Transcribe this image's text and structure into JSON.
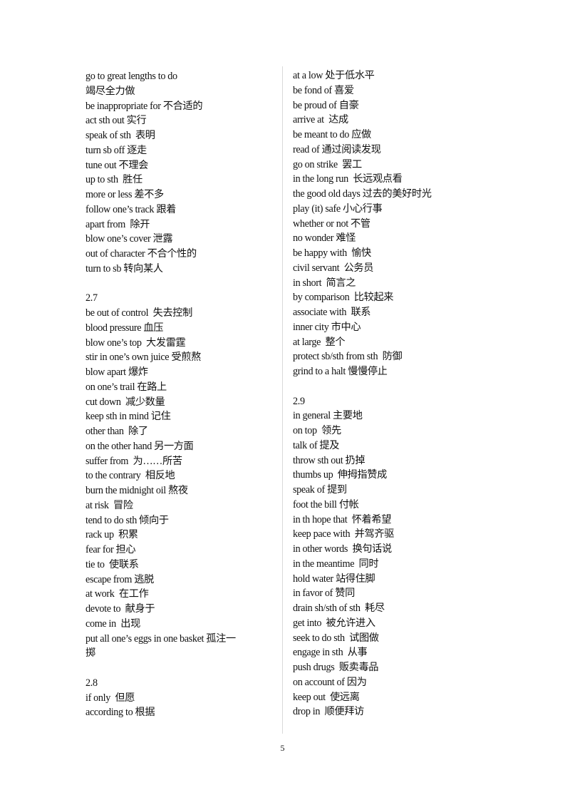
{
  "left_column": [
    {
      "type": "entry",
      "text": "go to great lengths to do"
    },
    {
      "type": "entry",
      "text": "竭尽全力做"
    },
    {
      "type": "entry",
      "text": "be inappropriate for 不合适的"
    },
    {
      "type": "entry",
      "text": "act sth out 实行"
    },
    {
      "type": "entry",
      "text": "speak of sth  表明"
    },
    {
      "type": "entry",
      "text": "turn sb off 逐走"
    },
    {
      "type": "entry",
      "text": "tune out 不理会"
    },
    {
      "type": "entry",
      "text": "up to sth  胜任"
    },
    {
      "type": "entry",
      "text": "more or less 差不多"
    },
    {
      "type": "entry",
      "text": "follow one’s track 跟着"
    },
    {
      "type": "entry",
      "text": "apart from  除开"
    },
    {
      "type": "entry",
      "text": "blow one’s cover 泄露"
    },
    {
      "type": "entry",
      "text": "out of character 不合个性的"
    },
    {
      "type": "entry",
      "text": "turn to sb 转向某人"
    },
    {
      "type": "blank",
      "text": ""
    },
    {
      "type": "heading",
      "text": "2.7"
    },
    {
      "type": "entry",
      "text": "be out of control  失去控制"
    },
    {
      "type": "entry",
      "text": "blood pressure 血压"
    },
    {
      "type": "entry",
      "text": "blow one’s top  大发雷霆"
    },
    {
      "type": "entry",
      "text": "stir in one’s own juice 受煎熬"
    },
    {
      "type": "entry",
      "text": "blow apart 爆炸"
    },
    {
      "type": "entry",
      "text": "on one’s trail 在路上"
    },
    {
      "type": "entry",
      "text": "cut down  减少数量"
    },
    {
      "type": "entry",
      "text": "keep sth in mind 记住"
    },
    {
      "type": "entry",
      "text": "other than  除了"
    },
    {
      "type": "entry",
      "text": "on the other hand 另一方面"
    },
    {
      "type": "entry",
      "text": "suffer from  为……所苦"
    },
    {
      "type": "entry",
      "text": "to the contrary  相反地"
    },
    {
      "type": "entry",
      "text": "burn the midnight oil 熬夜"
    },
    {
      "type": "entry",
      "text": "at risk  冒险"
    },
    {
      "type": "entry",
      "text": "tend to do sth 倾向于"
    },
    {
      "type": "entry",
      "text": "rack up  积累"
    },
    {
      "type": "entry",
      "text": "fear for 担心"
    },
    {
      "type": "entry",
      "text": "tie to  使联系"
    },
    {
      "type": "entry",
      "text": "escape from 逃脱"
    },
    {
      "type": "entry",
      "text": "at work  在工作"
    },
    {
      "type": "entry",
      "text": "devote to  献身于"
    },
    {
      "type": "entry",
      "text": "come in  出现"
    },
    {
      "type": "entry",
      "text": "put all one’s eggs in one basket 孤注一"
    },
    {
      "type": "entry",
      "text": "掷"
    },
    {
      "type": "blank",
      "text": ""
    },
    {
      "type": "heading",
      "text": "2.8"
    },
    {
      "type": "entry",
      "text": "if only  但愿"
    },
    {
      "type": "entry",
      "text": "according to 根据"
    }
  ],
  "right_column": [
    {
      "type": "entry",
      "text": "at a low 处于低水平"
    },
    {
      "type": "entry",
      "text": "be fond of 喜爱"
    },
    {
      "type": "entry",
      "text": "be proud of 自豪"
    },
    {
      "type": "entry",
      "text": "arrive at  达成"
    },
    {
      "type": "entry",
      "text": "be meant to do 应做"
    },
    {
      "type": "entry",
      "text": "read of 通过阅读发现"
    },
    {
      "type": "entry",
      "text": "go on strike  罢工"
    },
    {
      "type": "entry",
      "text": "in the long run  长远观点看"
    },
    {
      "type": "entry",
      "text": "the good old days 过去的美好时光"
    },
    {
      "type": "entry",
      "text": "play (it) safe 小心行事"
    },
    {
      "type": "entry",
      "text": "whether or not 不管"
    },
    {
      "type": "entry",
      "text": "no wonder 难怪"
    },
    {
      "type": "entry",
      "text": "be happy with  愉快"
    },
    {
      "type": "entry",
      "text": "civil servant  公务员"
    },
    {
      "type": "entry",
      "text": "in short  简言之"
    },
    {
      "type": "entry",
      "text": "by comparison  比较起来"
    },
    {
      "type": "entry",
      "text": "associate with  联系"
    },
    {
      "type": "entry",
      "text": "inner city 市中心"
    },
    {
      "type": "entry",
      "text": "at large  整个"
    },
    {
      "type": "entry",
      "text": "protect sb/sth from sth  防御"
    },
    {
      "type": "entry",
      "text": "grind to a halt 慢慢停止"
    },
    {
      "type": "blank",
      "text": ""
    },
    {
      "type": "heading",
      "text": "2.9"
    },
    {
      "type": "entry",
      "text": "in general 主要地"
    },
    {
      "type": "entry",
      "text": "on top  领先"
    },
    {
      "type": "entry",
      "text": "talk of 提及"
    },
    {
      "type": "entry",
      "text": "throw sth out 扔掉"
    },
    {
      "type": "entry",
      "text": "thumbs up  伸拇指赞成"
    },
    {
      "type": "entry",
      "text": "speak of 提到"
    },
    {
      "type": "entry",
      "text": "foot the bill 付帐"
    },
    {
      "type": "entry",
      "text": "in th hope that  怀着希望"
    },
    {
      "type": "entry",
      "text": "keep pace with  并驾齐驱"
    },
    {
      "type": "entry",
      "text": "in other words  换句话说"
    },
    {
      "type": "entry",
      "text": "in the meantime  同时"
    },
    {
      "type": "entry",
      "text": "hold water 站得住脚"
    },
    {
      "type": "entry",
      "text": "in favor of 赞同"
    },
    {
      "type": "entry",
      "text": "drain sh/sth of sth  耗尽"
    },
    {
      "type": "entry",
      "text": "get into  被允许进入"
    },
    {
      "type": "entry",
      "text": "seek to do sth  试图做"
    },
    {
      "type": "entry",
      "text": "engage in sth  从事"
    },
    {
      "type": "entry",
      "text": "push drugs  贩卖毒品"
    },
    {
      "type": "entry",
      "text": "on account of 因为"
    },
    {
      "type": "entry",
      "text": "keep out  使远离"
    },
    {
      "type": "entry",
      "text": "drop in  顺便拜访"
    }
  ],
  "footer": {
    "page_number": "5"
  }
}
